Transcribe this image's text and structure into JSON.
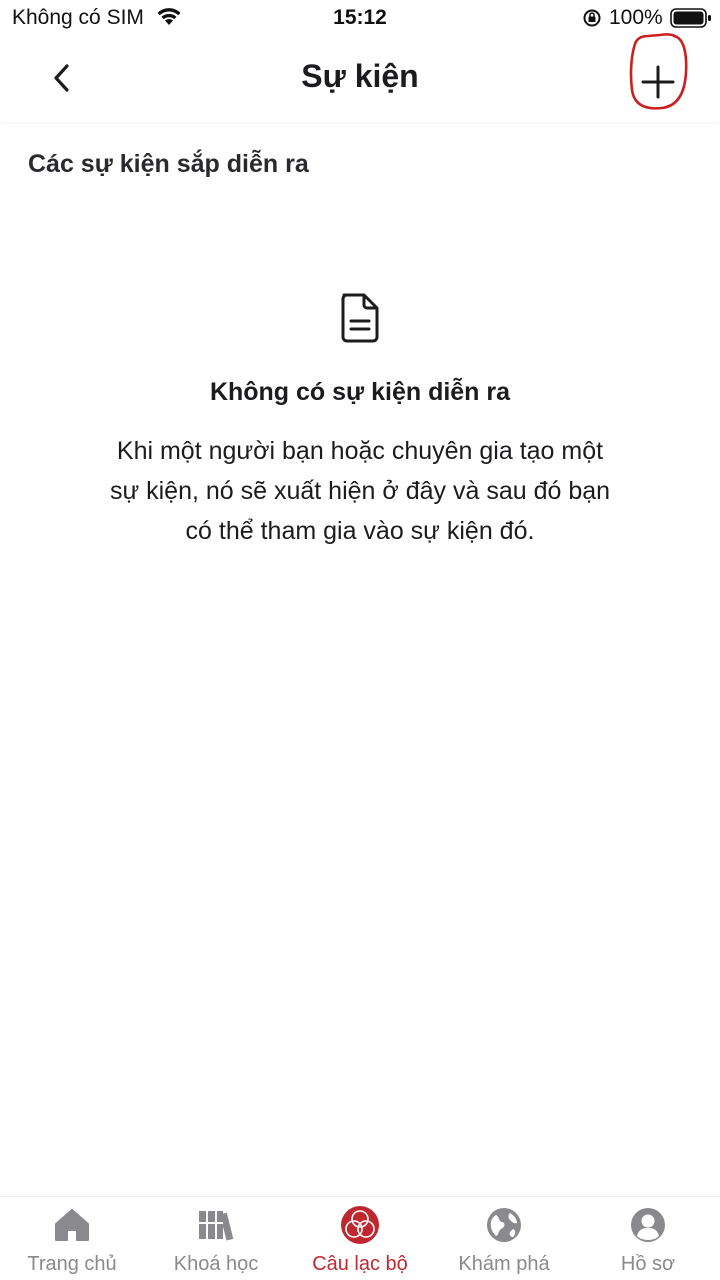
{
  "status_bar": {
    "carrier": "Không có SIM",
    "time": "15:12",
    "battery": "100%"
  },
  "header": {
    "title": "Sự kiện",
    "back_icon": "chevron-left-icon",
    "add_icon": "plus-icon",
    "annotation_color": "#cc1f1f"
  },
  "section": {
    "title": "Các sự kiện sắp diễn ra"
  },
  "empty_state": {
    "icon": "document-icon",
    "title": "Không có sự kiện diễn ra",
    "description": "Khi một người bạn hoặc chuyên gia tạo một sự kiện, nó sẽ xuất hiện ở đây và sau đó bạn có thể tham gia vào sự kiện đó."
  },
  "tab_bar": {
    "active_color": "#c0282f",
    "inactive_color": "#8a8a8e",
    "tabs": [
      {
        "label": "Trang chủ",
        "icon": "home-icon",
        "active": false
      },
      {
        "label": "Khoá học",
        "icon": "books-icon",
        "active": false
      },
      {
        "label": "Câu lạc bộ",
        "icon": "club-icon",
        "active": true
      },
      {
        "label": "Khám phá",
        "icon": "globe-icon",
        "active": false
      },
      {
        "label": "Hồ sơ",
        "icon": "profile-icon",
        "active": false
      }
    ]
  }
}
